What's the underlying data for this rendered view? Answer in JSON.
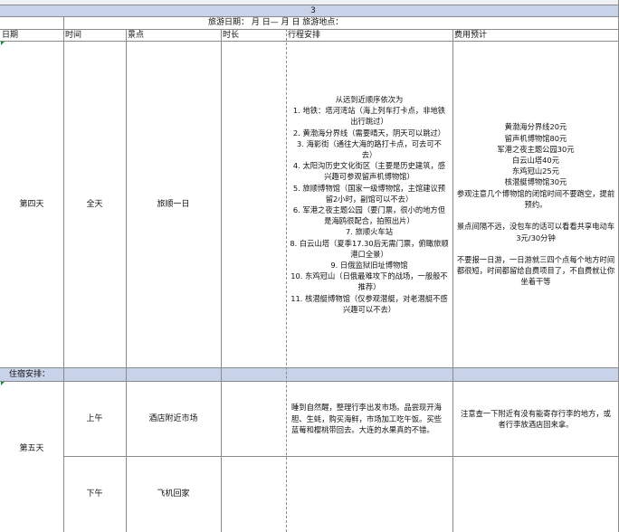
{
  "page_number": "3",
  "title_line": "旅游日期：      月      日—    月      日      旅游地点：",
  "headers": [
    "日期",
    "时间",
    "景点",
    "时长",
    "行程安排",
    "费用预计"
  ],
  "day4": {
    "day": "第四天",
    "time": "全天",
    "spot": "旅顺一日",
    "itinerary": "从远到近顺序依次为\n1. 地铁：塔河湾站（海上列车打卡点，非地铁出行跳过）\n2. 黄渤海分界线（需要晴天，阴天可以跳过）\n3. 海影街（通往大海的路打卡点，可去可不去）\n4. 太阳沟历史文化街区（主要是历史建筑，感兴趣可参观留声机博物馆）\n5. 旅顺博物馆（国家一级博物馆，主馆建议预留2小时，副馆可以不去）\n6. 军港之夜主题公园（要门票，很小的地方但是海鸥很配合，拍照出片）\n7. 旅顺火车站\n8. 白云山塔（夏季17.30后无需门票，俯瞰旅顺港口全景）\n9. 日俄监狱旧址博物馆\n10. 东鸡冠山（日俄最难攻下的战场，一般般不推荐）\n11. 核潜艇博物馆（仅参观潜艇，对老潜艇不感兴趣可以不去）",
    "cost": "黄渤海分界线20元\n留声机博物馆80元\n军港之夜主题公园30元\n白云山塔40元\n东鸡冠山25元\n核潜艇博物馆30元\n参观注意几个博物馆的闭馆时间不要跑空，提前预约。\n\n景点间隔不远，没包车的话可以看看共享电动车3元/30分钟\n\n不要报一日游，一日游就三四个点每个地方时间都很短，时间都留给自费项目了，不自费就让你坐着干等"
  },
  "stay_label": "住宿安排：",
  "day5": {
    "day": "第五天",
    "morning": {
      "time": "上午",
      "spot": "酒店附近市场",
      "itinerary": "睡到自然醒，整理行李出发市场。品尝现开海胆、生蚝，购买海鲜，市场加工吃午饭。买些蓝莓和樱桃带回去。大连的水果真的不错。",
      "cost": "注意查一下附近有没有能寄存行李的地方，或者行李放酒店回来拿。"
    },
    "afternoon": {
      "time": "下午",
      "spot": "飞机回家"
    }
  }
}
